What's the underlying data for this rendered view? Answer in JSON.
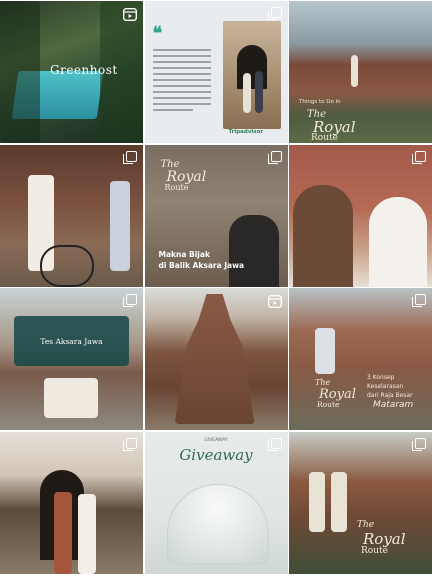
{
  "feed": {
    "tiles": [
      {
        "id": "t1",
        "type": "video",
        "brand": "Greenhost"
      },
      {
        "id": "t2",
        "type": "carousel",
        "footer_brand": "Tripadvisor"
      },
      {
        "id": "t3",
        "type": "image",
        "caption_top": "Things to Do in",
        "title_the": "The",
        "title_royal": "Royal",
        "title_route": "Route"
      },
      {
        "id": "t4",
        "type": "carousel"
      },
      {
        "id": "t5",
        "type": "carousel",
        "title_the": "The",
        "title_royal": "Royal",
        "title_route": "Route",
        "caption_line1": "Makna Bijak",
        "caption_line2": "di Balik Aksara Jawa"
      },
      {
        "id": "t6",
        "type": "carousel"
      },
      {
        "id": "t7",
        "type": "carousel",
        "card_text": "Tes Aksara Jawa"
      },
      {
        "id": "t8",
        "type": "image"
      },
      {
        "id": "t9",
        "type": "carousel",
        "title_the": "The",
        "title_royal": "Royal",
        "title_route": "Route",
        "caption_line1": "3 Konsep",
        "caption_line2": "Keselarasan",
        "caption_line3": "dari Raja Besar",
        "caption_line4": "Mataram"
      },
      {
        "id": "t10",
        "type": "carousel"
      },
      {
        "id": "t11",
        "type": "carousel",
        "header": "GIVEAWAY",
        "title": "Giveaway"
      },
      {
        "id": "t12",
        "type": "carousel",
        "title_the": "The",
        "title_royal": "Royal",
        "title_route": "Route"
      }
    ]
  },
  "colors": {
    "teal_accent": "#3aa38c",
    "cream_text": "#f2e9d8"
  },
  "icons": {
    "video": "reel-icon",
    "carousel": "multiple-images-icon"
  }
}
